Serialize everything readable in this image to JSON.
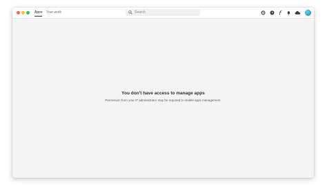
{
  "window": {
    "traffic_lights": {
      "close_color": "#ff5f57",
      "minimize_color": "#febc2e",
      "zoom_color": "#28c840"
    }
  },
  "nav": {
    "tabs": [
      {
        "label": "Apps",
        "active": true
      },
      {
        "label": "Your work",
        "active": false
      }
    ]
  },
  "search": {
    "icon": "search-icon",
    "placeholder": "Search"
  },
  "header_icons": [
    {
      "name": "fonts-icon"
    },
    {
      "name": "help-icon"
    },
    {
      "name": "font-f-icon"
    },
    {
      "name": "notifications-bell-icon"
    },
    {
      "name": "cloud-icon"
    }
  ],
  "user": {
    "avatar_color": "#1d9ec4"
  },
  "main": {
    "empty_state": {
      "title": "You don't have access to manage apps",
      "message": "Permission from your IT administrator may be required to enable apps management."
    }
  }
}
